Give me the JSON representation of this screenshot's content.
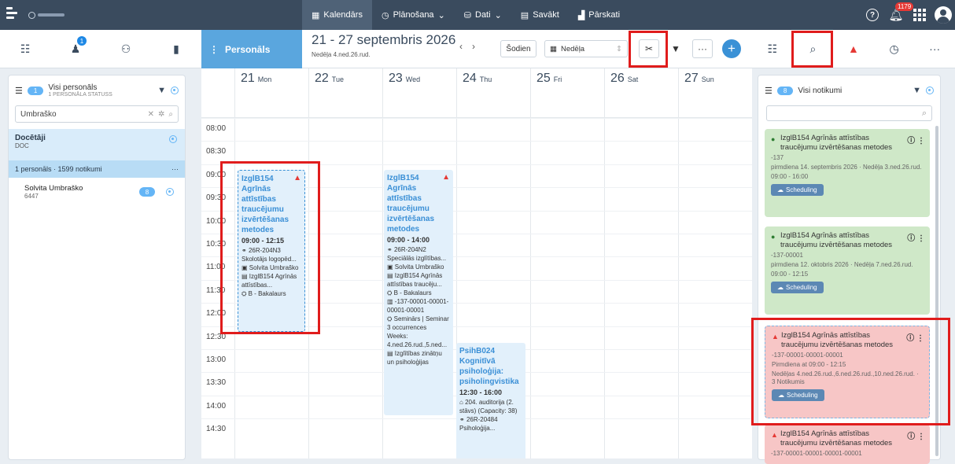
{
  "nav": {
    "items": [
      {
        "label": "Kalendārs",
        "icon": "calendar-icon",
        "active": true
      },
      {
        "label": "Plānošana",
        "icon": "clock-icon",
        "dropdown": true
      },
      {
        "label": "Dati",
        "icon": "database-icon",
        "dropdown": true
      },
      {
        "label": "Savākt",
        "icon": "collect-icon"
      },
      {
        "label": "Pārskati",
        "icon": "chart-icon"
      }
    ],
    "notification_count": "1179"
  },
  "left_toolbar": {
    "badge": "1"
  },
  "left_panel": {
    "pill": "1",
    "title": "Visi personāls",
    "subtitle": "1 PERSONĀLA STATUSS",
    "search_value": "Umbraško",
    "group_name": "Docētāji",
    "group_code": "DOC",
    "count_line": "1 personāls · 1599 notikumi",
    "person_name": "Solvita Umbraško",
    "person_id": "6447",
    "person_badge": "8"
  },
  "calendar_header": {
    "tab_label": "Personāls",
    "date_range": "21 - 27 septembris 2026",
    "week_sub": "Nedēļa 4.ned.26.rud.",
    "today_label": "Šodien",
    "view_label": "Nedēļa"
  },
  "days": [
    {
      "num": "21",
      "name": "Mon"
    },
    {
      "num": "22",
      "name": "Tue"
    },
    {
      "num": "23",
      "name": "Wed"
    },
    {
      "num": "24",
      "name": "Thu"
    },
    {
      "num": "25",
      "name": "Fri"
    },
    {
      "num": "26",
      "name": "Sat"
    },
    {
      "num": "27",
      "name": "Sun"
    }
  ],
  "times": [
    "08:00",
    "08:30",
    "09:00",
    "09:30",
    "10:00",
    "10:30",
    "11:00",
    "11:30",
    "12:00",
    "12:30",
    "13:00",
    "13:30",
    "14:00",
    "14:30"
  ],
  "events": {
    "mon": {
      "title": "IzglB154 Agrīnās attīstības traucējumu izvērtēšanas metodes",
      "time": "09:00 - 12:15",
      "lines": [
        "26R-204N3",
        "Skolotājs logopēd...",
        "Solvita Umbraško",
        "IzglB154 Agrīnās attīstības...",
        "B - Bakalaurs"
      ]
    },
    "wed": {
      "title": "IzglB154 Agrīnās attīstības traucējumu izvērtēšanas metodes",
      "time": "09:00 - 14:00",
      "lines": [
        "26R-204N2",
        "Speciālās izglītības...",
        "Solvita Umbraško",
        "IzglB154 Agrīnās attīstības traucēju...",
        "B - Bakalaurs",
        "-137-00001-00001-00001-00001",
        "Seminārs | Seminar",
        "3 occurrences",
        "Weeks: 4.ned.26.rud.,5.ned...",
        "Izglītības zinātņu un psiholoģijas"
      ]
    },
    "thu": {
      "title": "PsihB024 Kognitīvā psiholoģija: psiholingvistika",
      "time": "12:30 - 16:00",
      "lines": [
        "204. auditorija (2. stāvs) (Capacity: 38)",
        "26R-20484",
        "Psiholoģija..."
      ]
    }
  },
  "right_panel": {
    "pill": "8",
    "title": "Visi notikumi",
    "cards": [
      {
        "title": "IzglB154 Agrīnās attīstības traucējumu izvērtēšanas metodes",
        "code": "-137",
        "date": "pirmdiena 14. septembris 2026 · Nedēļa 3.ned.26.rud.",
        "time": "09:00 - 16:00",
        "button": "Scheduling"
      },
      {
        "title": "IzglB154 Agrīnās attīstības traucējumu izvērtēšanas metodes",
        "code": "-137-00001",
        "date": "pirmdiena 12. oktobris 2026 · Nedēļa 7.ned.26.rud.",
        "time": "09:00 - 12:15",
        "button": "Scheduling"
      },
      {
        "title": "IzglB154 Agrīnās attīstības traucējumu izvērtēšanas metodes",
        "code": "-137-00001-00001-00001",
        "date": "Pirmdiena at 09:00 - 12:15",
        "time": "Nedēļas 4.ned.26.rud.,6.ned.26.rud.,10.ned.26.rud. · 3 Notikumis",
        "button": "Scheduling"
      },
      {
        "title": "IzglB154 Agrīnās attīstības traucējumu izvērtēšanas metodes",
        "code": "-137-00001-00001-00001-00001"
      }
    ]
  },
  "colors": {
    "accent": "#5aa6de",
    "topbar": "#3a4b5e",
    "highlight": "#e01c1c"
  }
}
